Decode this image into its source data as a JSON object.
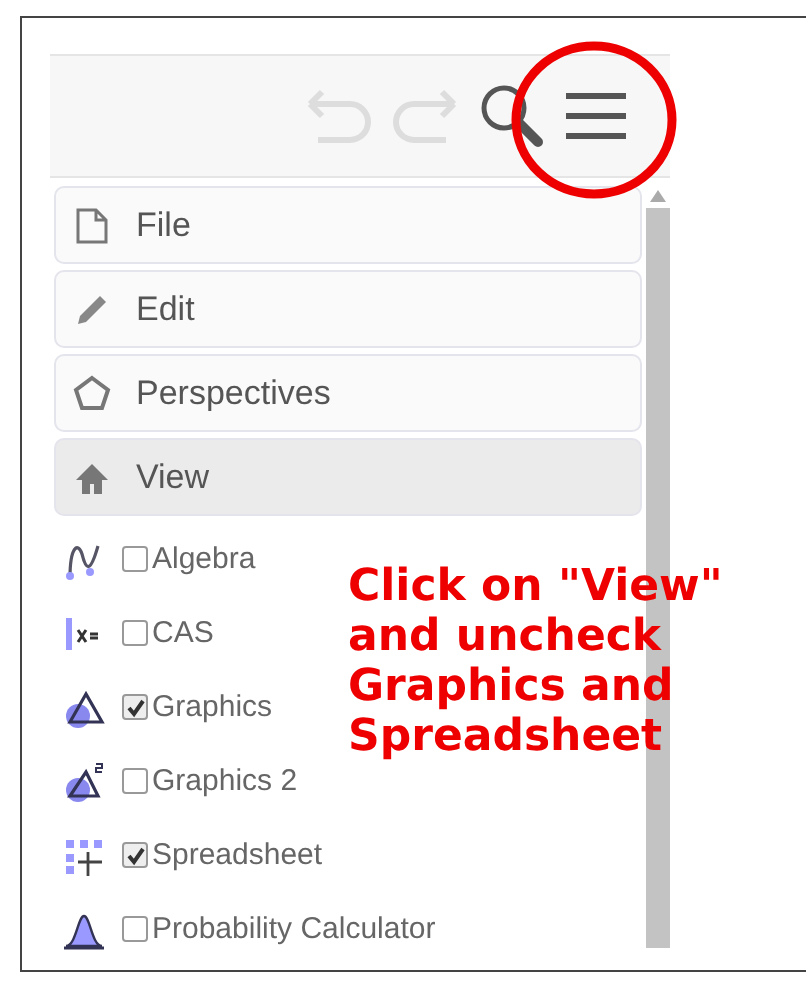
{
  "toolbar": {
    "highlighted": true
  },
  "menu": [
    {
      "label": "File",
      "selected": false
    },
    {
      "label": "Edit",
      "selected": false
    },
    {
      "label": "Perspectives",
      "selected": false
    },
    {
      "label": "View",
      "selected": true
    }
  ],
  "views": [
    {
      "label": "Algebra",
      "checked": false
    },
    {
      "label": "CAS",
      "checked": false
    },
    {
      "label": "Graphics",
      "checked": true
    },
    {
      "label": "Graphics 2",
      "checked": false
    },
    {
      "label": "Spreadsheet",
      "checked": true
    },
    {
      "label": "Probability Calculator",
      "checked": false
    }
  ],
  "annotation": "Click on \"View\" and uncheck Graphics and Spreadsheet"
}
